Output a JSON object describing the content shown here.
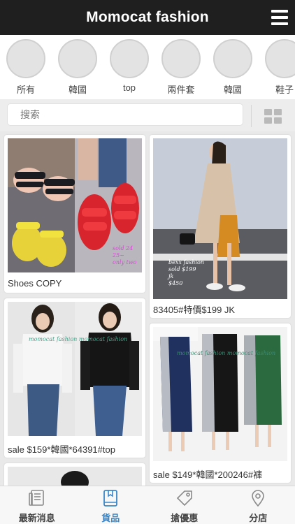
{
  "header": {
    "title": "Momocat fashion",
    "menu_icon": "hamburger-icon"
  },
  "categories": [
    {
      "label": "所有"
    },
    {
      "label": "韓國"
    },
    {
      "label": "top"
    },
    {
      "label": "兩件套"
    },
    {
      "label": "韓國"
    },
    {
      "label": "鞋子"
    }
  ],
  "search": {
    "placeholder": "搜索",
    "grid_icon": "grid-view-icon"
  },
  "products": [
    {
      "caption": "Shoes COPY",
      "watermark": "sold 24 / 25~ / only two"
    },
    {
      "caption": "83405#特價$199 JK",
      "watermark": "bexx fashion / sold $199 / jk / $450"
    },
    {
      "caption": "sale $159*韓國*64391#top",
      "watermark": "momocat fashion  momocat fashion"
    },
    {
      "caption": "sale $149*韓國*200246#褲",
      "watermark": "momocat fashion  momocat fashion"
    }
  ],
  "bottom_nav": {
    "items": [
      {
        "label": "最新消息",
        "icon": "news-icon"
      },
      {
        "label": "貨品",
        "icon": "book-icon"
      },
      {
        "label": "搶優惠",
        "icon": "tag-icon"
      },
      {
        "label": "分店",
        "icon": "location-pin-icon"
      }
    ],
    "active_color": "#3a86c8"
  }
}
